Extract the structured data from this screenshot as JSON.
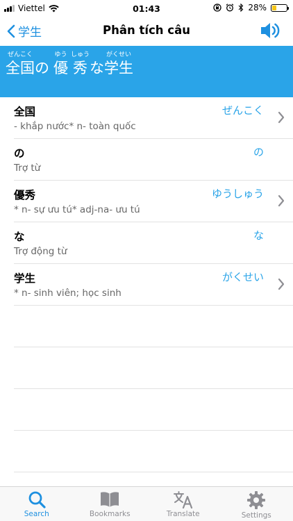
{
  "status_bar": {
    "carrier": "Viettel",
    "time": "01:43",
    "battery_percent": "28%",
    "battery_level": 0.28,
    "battery_color": "#f5c518"
  },
  "nav": {
    "back_label": "学生",
    "title": "Phân tích câu",
    "speaker_icon": "speaker-icon"
  },
  "sentence": {
    "segments": [
      {
        "text": "全国",
        "furigana": "ぜんこく"
      },
      {
        "text": "の",
        "furigana": ""
      },
      {
        "text": "優",
        "furigana": "ゆう"
      },
      {
        "text": "秀",
        "furigana": "しゅう"
      },
      {
        "text": "な",
        "furigana": ""
      },
      {
        "text": "学生",
        "furigana": "がくせい"
      }
    ]
  },
  "words": [
    {
      "word": "全国",
      "reading": "ぜんこく",
      "meaning": "- khắp nước* n- toàn quốc",
      "has_detail": true
    },
    {
      "word": "の",
      "reading": "の",
      "meaning": "Trợ từ",
      "has_detail": false
    },
    {
      "word": "優秀",
      "reading": "ゆうしゅう",
      "meaning": "* n- sự ưu tú* adj-na- ưu tú",
      "has_detail": true
    },
    {
      "word": "な",
      "reading": "な",
      "meaning": "Trợ động từ",
      "has_detail": false
    },
    {
      "word": "学生",
      "reading": "がくせい",
      "meaning": "* n- sinh viên; học sinh",
      "has_detail": true
    }
  ],
  "tabs": [
    {
      "label": "Search",
      "icon": "search-icon",
      "active": true
    },
    {
      "label": "Bookmarks",
      "icon": "book-icon",
      "active": false
    },
    {
      "label": "Translate",
      "icon": "translate-icon",
      "active": false
    },
    {
      "label": "Settings",
      "icon": "gear-icon",
      "active": false
    }
  ],
  "colors": {
    "accent": "#1e90e0",
    "banner": "#2aa4e8",
    "inactive_tab": "#8e8e93"
  }
}
